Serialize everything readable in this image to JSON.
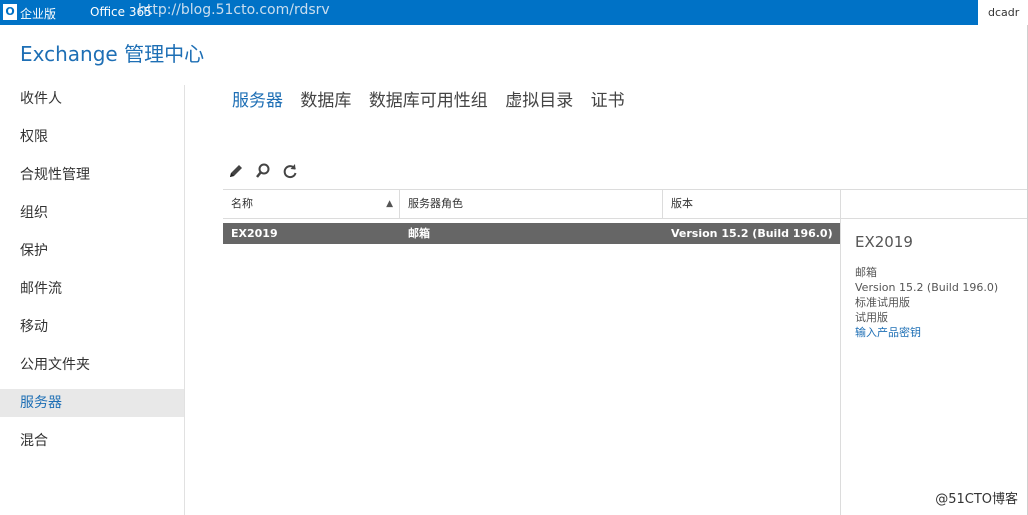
{
  "topbar": {
    "logo_text": "O",
    "enterprise_label": "企业版",
    "office365_label": "Office 365",
    "watermark_url": "http://blog.51cto.com/rdsrv",
    "user_label": "dcadr"
  },
  "app": {
    "title": "Exchange 管理中心"
  },
  "sidebar": {
    "items": [
      {
        "label": "收件人"
      },
      {
        "label": "权限"
      },
      {
        "label": "合规性管理"
      },
      {
        "label": "组织"
      },
      {
        "label": "保护"
      },
      {
        "label": "邮件流"
      },
      {
        "label": "移动"
      },
      {
        "label": "公用文件夹"
      },
      {
        "label": "服务器",
        "active": true
      },
      {
        "label": "混合"
      }
    ]
  },
  "tabs": [
    {
      "label": "服务器",
      "active": true
    },
    {
      "label": "数据库"
    },
    {
      "label": "数据库可用性组"
    },
    {
      "label": "虚拟目录"
    },
    {
      "label": "证书"
    }
  ],
  "toolbar": {
    "icons": [
      "pencil-icon",
      "search-icon",
      "refresh-icon"
    ]
  },
  "grid": {
    "columns": [
      "名称",
      "服务器角色",
      "版本"
    ],
    "sort_indicator": "▲",
    "rows": [
      {
        "name": "EX2019",
        "role": "邮箱",
        "version": "Version 15.2 (Build 196.0)"
      }
    ]
  },
  "details": {
    "name": "EX2019",
    "role": "邮箱",
    "version": "Version 15.2 (Build 196.0)",
    "edition": "标准试用版",
    "license": "试用版",
    "link": "输入产品密钥"
  },
  "watermark": {
    "text": "@51CTO博客"
  },
  "colors": {
    "topbar": "#0072c6",
    "accent": "#1e6fb5",
    "selected_row": "#666666"
  }
}
